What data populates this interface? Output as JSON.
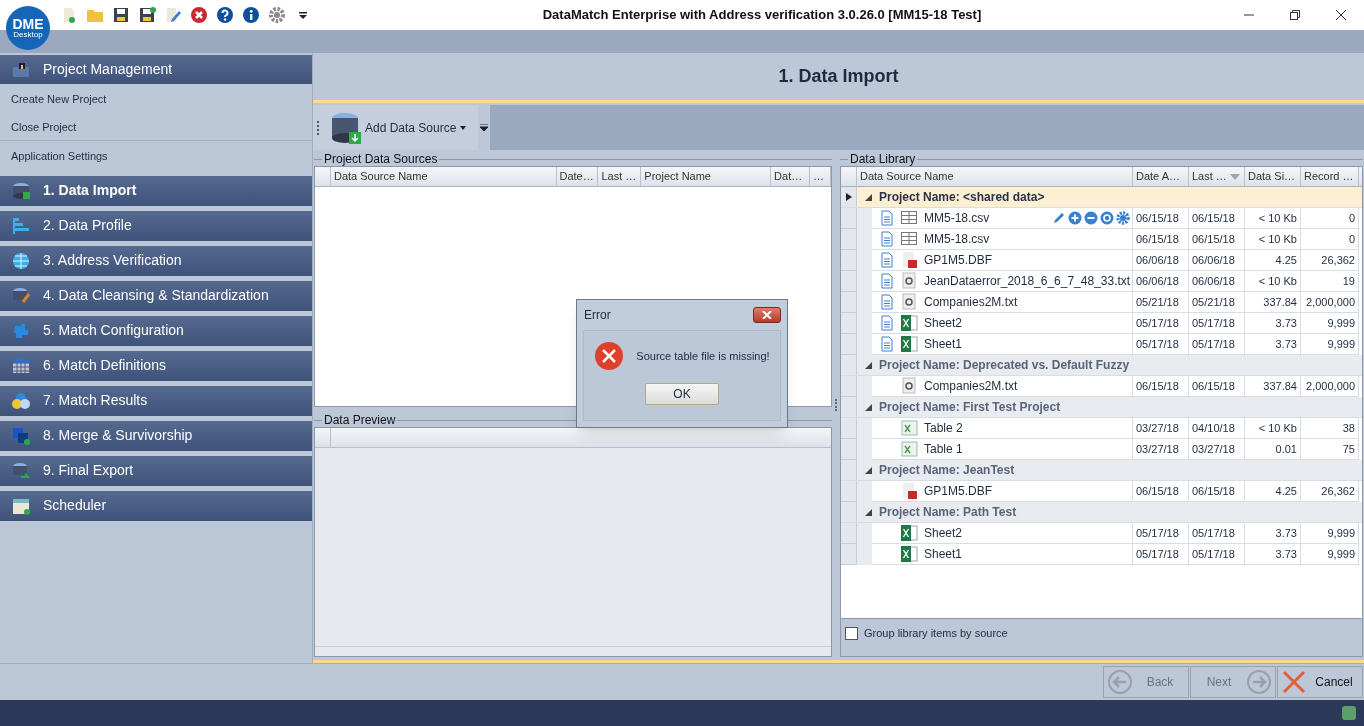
{
  "window": {
    "title": "DataMatch Enterprise with Address verification 3.0.26.0 [MM15-18 Test]",
    "logo": "DME",
    "logo_sub": "Desktop"
  },
  "sidebar": {
    "section": "Project Management",
    "links": [
      {
        "label": "Create New Project",
        "divider_after": false
      },
      {
        "label": "Close Project",
        "divider_after": true
      },
      {
        "label": "Application Settings",
        "divider_after": false
      }
    ],
    "steps": [
      {
        "label": "1. Data Import",
        "kind": "import",
        "selected": true
      },
      {
        "label": "2. Data Profile",
        "kind": "profile",
        "selected": false
      },
      {
        "label": "3. Address Verification",
        "kind": "globe",
        "selected": false
      },
      {
        "label": "4. Data Cleansing & Standardization",
        "kind": "cleanse",
        "selected": false
      },
      {
        "label": "5. Match Configuration",
        "kind": "config",
        "selected": false
      },
      {
        "label": "6. Match Definitions",
        "kind": "grid",
        "selected": false
      },
      {
        "label": "7. Match Results",
        "kind": "results",
        "selected": false
      },
      {
        "label": "8. Merge & Survivorship",
        "kind": "merge",
        "selected": false
      },
      {
        "label": "9. Final Export",
        "kind": "export",
        "selected": false
      },
      {
        "label": "Scheduler",
        "kind": "calendar",
        "selected": false
      }
    ]
  },
  "page_title": "1. Data Import",
  "toolbar": {
    "add_button": "Add Data Source"
  },
  "sources": {
    "title": "Project Data Sources",
    "columns": [
      "Data Source Name",
      "Date…",
      "Last …",
      "Project Name",
      "Dat…",
      "…"
    ]
  },
  "preview": {
    "title": "Data Preview"
  },
  "library": {
    "title": "Data Library",
    "columns": [
      "Data Source Name",
      "Date A…",
      "Last …",
      "Data Si…",
      "Record …"
    ],
    "groups": [
      {
        "label": "Project Name: <shared data>",
        "selected": true,
        "expanded": true,
        "rows": [
          {
            "name": "MM5-18.csv",
            "kind": "csv",
            "linked": true,
            "actions": true,
            "added": "06/15/18",
            "last": "06/15/18",
            "size": "< 10 Kb",
            "records": "0"
          },
          {
            "name": "MM5-18.csv",
            "kind": "csv",
            "linked": true,
            "actions": false,
            "added": "06/15/18",
            "last": "06/15/18",
            "size": "< 10 Kb",
            "records": "0"
          },
          {
            "name": "GP1M5.DBF",
            "kind": "dbf",
            "linked": true,
            "actions": false,
            "added": "06/06/18",
            "last": "06/06/18",
            "size": "4.25",
            "records": "26,362"
          },
          {
            "name": "JeanDataerror_2018_6_6_7_48_33.txt",
            "kind": "txt",
            "linked": true,
            "actions": false,
            "added": "06/06/18",
            "last": "06/06/18",
            "size": "< 10 Kb",
            "records": "19"
          },
          {
            "name": "Companies2M.txt",
            "kind": "txt",
            "linked": true,
            "actions": false,
            "added": "05/21/18",
            "last": "05/21/18",
            "size": "337.84",
            "records": "2,000,000"
          },
          {
            "name": "Sheet2",
            "kind": "excel",
            "linked": true,
            "actions": false,
            "added": "05/17/18",
            "last": "05/17/18",
            "size": "3.73",
            "records": "9,999"
          },
          {
            "name": "Sheet1",
            "kind": "excel",
            "linked": true,
            "actions": false,
            "added": "05/17/18",
            "last": "05/17/18",
            "size": "3.73",
            "records": "9,999"
          }
        ]
      },
      {
        "label": "Project Name: Deprecated vs. Default Fuzzy",
        "selected": false,
        "expanded": true,
        "rows": [
          {
            "name": "Companies2M.txt",
            "kind": "txt",
            "linked": false,
            "actions": false,
            "added": "06/15/18",
            "last": "06/15/18",
            "size": "337.84",
            "records": "2,000,000"
          }
        ]
      },
      {
        "label": "Project Name: First Test Project",
        "selected": false,
        "expanded": true,
        "rows": [
          {
            "name": "Table 2",
            "kind": "excel_table",
            "linked": false,
            "actions": false,
            "added": "03/27/18",
            "last": "04/10/18",
            "size": "< 10 Kb",
            "records": "38"
          },
          {
            "name": "Table 1",
            "kind": "excel_table",
            "linked": false,
            "actions": false,
            "added": "03/27/18",
            "last": "03/27/18",
            "size": "0.01",
            "records": "75"
          }
        ]
      },
      {
        "label": "Project Name: JeanTest",
        "selected": false,
        "expanded": true,
        "rows": [
          {
            "name": "GP1M5.DBF",
            "kind": "dbf",
            "linked": false,
            "actions": false,
            "added": "06/15/18",
            "last": "06/15/18",
            "size": "4.25",
            "records": "26,362"
          }
        ]
      },
      {
        "label": "Project Name: Path Test",
        "selected": false,
        "expanded": true,
        "rows": [
          {
            "name": "Sheet2",
            "kind": "excel",
            "linked": false,
            "actions": false,
            "added": "05/17/18",
            "last": "05/17/18",
            "size": "3.73",
            "records": "9,999"
          },
          {
            "name": "Sheet1",
            "kind": "excel",
            "linked": false,
            "actions": false,
            "added": "05/17/18",
            "last": "05/17/18",
            "size": "3.73",
            "records": "9,999"
          }
        ]
      }
    ],
    "group_by_source": {
      "label": "Group library items by source",
      "checked": false
    }
  },
  "dialog": {
    "title": "Error",
    "message": "Source table file is missing!",
    "button": "OK"
  },
  "footer": {
    "buttons": [
      {
        "label": "Back",
        "kind": "back",
        "disabled": true
      },
      {
        "label": "Next",
        "kind": "next",
        "disabled": true
      },
      {
        "label": "Cancel",
        "kind": "cancel",
        "disabled": false
      }
    ]
  }
}
